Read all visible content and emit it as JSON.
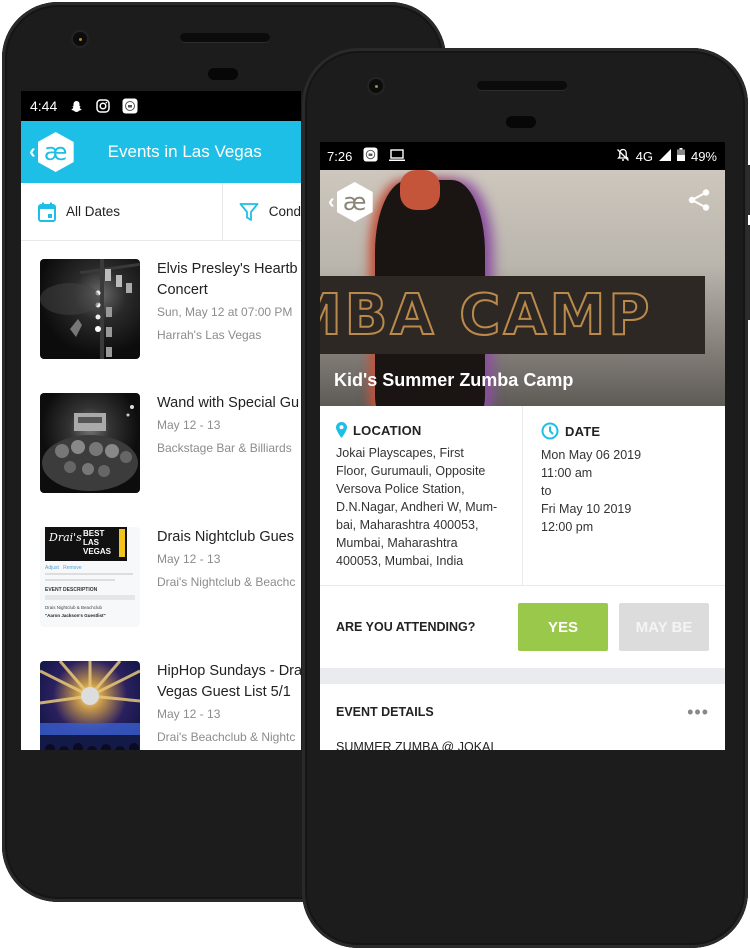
{
  "back_phone": {
    "status_bar": {
      "time": "4:44",
      "icons": [
        "snapchat-icon",
        "instagram-icon",
        "app-notification-icon"
      ]
    },
    "app_bar": {
      "back_icon": "chevron-left-icon",
      "logo_glyph": "æ",
      "title": "Events in Las Vegas",
      "color": "#1ebfe6"
    },
    "filters": [
      {
        "icon": "calendar-icon",
        "label": "All Dates"
      },
      {
        "icon": "filter-icon",
        "label": "Cond"
      }
    ],
    "events": [
      {
        "title_lines": [
          "Elvis Presley's Heartb",
          "Concert"
        ],
        "date": "Sun, May 12 at 07:00 PM",
        "venue": "Harrah's Las Vegas"
      },
      {
        "title_lines": [
          "Wand with Special Gu"
        ],
        "date": "May 12 - 13",
        "venue": "Backstage Bar & Billiards"
      },
      {
        "title_lines": [
          "Drais Nightclub Gues"
        ],
        "date": "May 12 - 13",
        "venue": "Drai's Nightclub & Beachc"
      },
      {
        "title_lines": [
          "HipHop Sundays - Dra",
          "Vegas Guest List 5/1"
        ],
        "date": "May 12 - 13",
        "venue": "Drai's Beachclub & Nightc"
      }
    ],
    "thumb3_text": {
      "brand": "Drai's",
      "badge": "BEST LAS VEGAS",
      "adjust": "Adjust",
      "remove": "Remove",
      "section": "EVENT DESCRIPTION",
      "line1": "Drais Nightclub & Beachclub",
      "line2": "\"Aaron Jackson's Guestlist\""
    }
  },
  "front_phone": {
    "status_bar": {
      "time": "7:26",
      "network": "4G",
      "battery": "49%"
    },
    "hero": {
      "banner_text": "MBA CAMP",
      "logo_glyph": "æ",
      "title": "Kid's Summer Zumba Camp"
    },
    "location": {
      "label": "LOCATION",
      "lines": [
        "Jokai Playscapes, First",
        "Floor, Gurumauli, Opposite",
        "Versova Police Station,",
        "D.N.Nagar, Andheri W, Mum-",
        "bai, Maharashtra 400053,",
        "Mumbai, Maharashtra",
        "400053, Mumbai, India"
      ]
    },
    "date": {
      "label": "DATE",
      "lines": [
        "Mon May 06 2019",
        "11:00 am",
        "to",
        "Fri May 10 2019",
        "12:00 pm"
      ]
    },
    "attending": {
      "label": "ARE YOU ATTENDING?",
      "yes": "YES",
      "maybe": "MAY BE",
      "yes_color": "#9ac84b"
    },
    "details": {
      "label": "EVENT DETAILS",
      "more": "•••",
      "first_line": "SUMMER ZUMBA @ JOKAI"
    }
  }
}
